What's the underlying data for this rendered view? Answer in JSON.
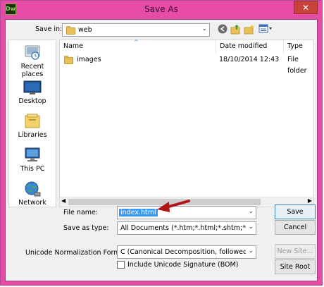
{
  "window": {
    "title": "Save As",
    "app_icon_label": "Dw",
    "close_glyph": "✕"
  },
  "toolbar": {
    "save_in_label": "Save in:",
    "location": "web"
  },
  "places": [
    {
      "label": "Recent places",
      "icon": "recent-places-icon"
    },
    {
      "label": "Desktop",
      "icon": "desktop-icon"
    },
    {
      "label": "Libraries",
      "icon": "libraries-icon"
    },
    {
      "label": "This PC",
      "icon": "computer-icon"
    },
    {
      "label": "Network",
      "icon": "network-icon"
    }
  ],
  "file_list": {
    "columns": [
      "Name",
      "Date modified",
      "Type"
    ],
    "rows": [
      {
        "name": "images",
        "date": "18/10/2014 12:43",
        "type": "File folder"
      }
    ]
  },
  "form": {
    "file_name_label": "File name:",
    "file_name_value": "index.html",
    "save_type_label": "Save as type:",
    "save_type_value": "All Documents (*.htm;*.html;*.shtm;*.shtml;*.hta;",
    "unicode_label": "Unicode Normalization Form:",
    "unicode_value": "C (Canonical Decomposition, followed by Canc",
    "signature_label": "Include Unicode Signature (BOM)"
  },
  "buttons": {
    "save": "Save",
    "cancel": "Cancel",
    "new_site": "New Site...",
    "site_root": "Site Root"
  },
  "colors": {
    "title_bar": "#e64ca6",
    "close_button": "#c7433a",
    "selection": "#3399ff",
    "annotation_arrow": "#b01818"
  }
}
